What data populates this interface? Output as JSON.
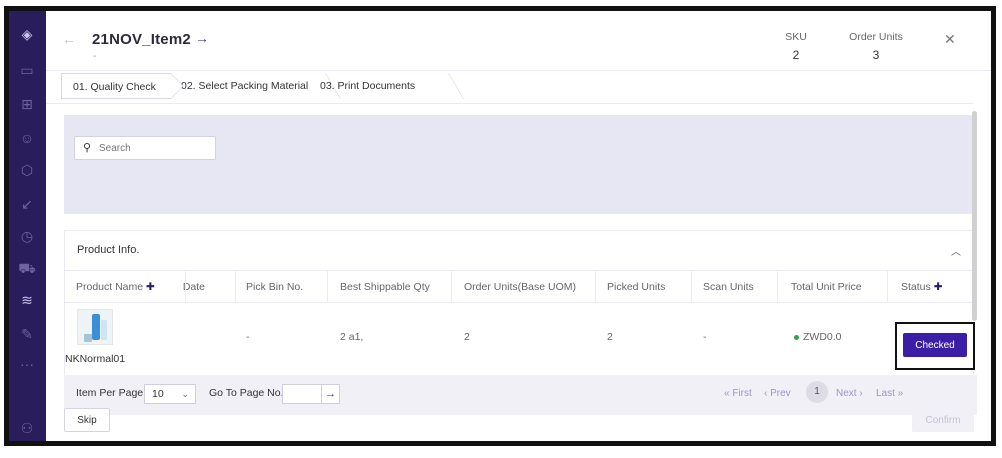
{
  "header": {
    "title": "21NOV_Item2",
    "subtitle": "-",
    "sku_label": "SKU",
    "sku_value": "2",
    "order_units_label": "Order Units",
    "order_units_value": "3"
  },
  "steps": [
    {
      "label": "01. Quality Check"
    },
    {
      "label": "02. Select Packing Material"
    },
    {
      "label": "03. Print Documents"
    }
  ],
  "search": {
    "placeholder": "Search"
  },
  "product_info": {
    "title": "Product Info.",
    "columns": [
      "Product Name",
      "Date",
      "Pick Bin No.",
      "Best Shippable Qty",
      "Order Units(Base UOM)",
      "Picked Units",
      "Scan Units",
      "Total Unit Price",
      "Status"
    ],
    "rows": [
      {
        "product_name": "NKNormal01",
        "date": "",
        "pick_bin_no": "-",
        "best_shippable_qty": "2 a1,",
        "order_units": "2",
        "picked_units": "2",
        "scan_units": "-",
        "total_unit_price": "ZWD0.0",
        "status": "Checked"
      }
    ]
  },
  "pagination": {
    "item_per_page_label": "Item Per Page",
    "item_per_page_value": "10",
    "goto_label": "Go To Page No.",
    "first": "First",
    "prev": "Prev",
    "current": "1",
    "next": "Next",
    "last": "Last"
  },
  "footer": {
    "skip": "Skip",
    "confirm": "Confirm"
  },
  "colors": {
    "sidebar": "#2a1d5c",
    "primary": "#3a1fa6",
    "success_dot": "#2ba84a",
    "search_area": "#e7e6f3"
  }
}
